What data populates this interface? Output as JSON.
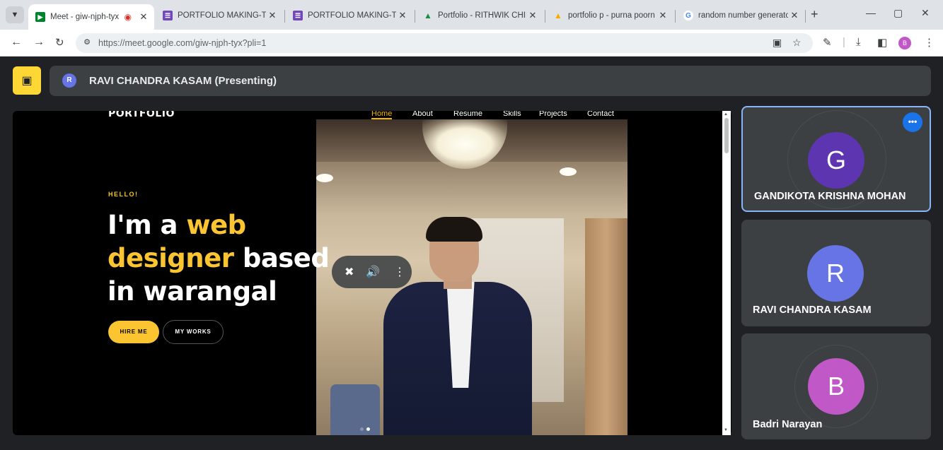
{
  "browser": {
    "tabs": [
      {
        "title": "Meet - giw-njph-tyx",
        "favicon": "google-meet-icon",
        "active": true,
        "recording": true
      },
      {
        "title": "PORTFOLIO MAKING-TEC",
        "favicon": "google-forms-icon"
      },
      {
        "title": "PORTFOLIO MAKING-TEC",
        "favicon": "google-forms-icon"
      },
      {
        "title": "Portfolio - RITHWIK CHIM",
        "favicon": "google-drive-icon"
      },
      {
        "title": "portfolio p - purna poorn",
        "favicon": "google-drive-icon"
      },
      {
        "title": "random number generato",
        "favicon": "google-icon"
      }
    ],
    "new_tab_symbol": "+",
    "address": {
      "url": "https://meet.google.com/giw-njph-tyx?pli=1"
    },
    "profile_initial": "B",
    "colors": {
      "tabbar": "#dfe3e7",
      "toolbar": "#ffffff",
      "omnibox": "#edf0f3"
    }
  },
  "meet": {
    "presenter_label": "RAVI CHANDRA KASAM (Presenting)",
    "presenter_initial": "R",
    "shared_screen": {
      "logo": "PORTFOLIO",
      "nav": [
        "Home",
        "About",
        "Resume",
        "Skills",
        "Projects",
        "Contact"
      ],
      "hello": "HELLO!",
      "hero_line1_a": "I'm a ",
      "hero_line1_b": "web",
      "hero_line2_a": "designer",
      "hero_line2_b": " based",
      "hero_line3": "in warangal",
      "hire_btn": "HIRE ME",
      "works_btn": "MY WORKS",
      "accent_color": "#fbc531"
    },
    "participants": [
      {
        "initial": "G",
        "name": "GANDIKOTA KRISHNA MOHAN",
        "color": "#5e35b1",
        "speaking": true
      },
      {
        "initial": "R",
        "name": "RAVI CHANDRA KASAM",
        "color": "#6674e6",
        "speaking": false
      },
      {
        "initial": "B",
        "name": "Badri Narayan",
        "color": "#c058c8",
        "speaking": false
      }
    ],
    "colors": {
      "background": "#202124",
      "tile": "#3c4043",
      "present_toggle": "#fdd835",
      "speaking_border": "#8ab4f8"
    }
  }
}
